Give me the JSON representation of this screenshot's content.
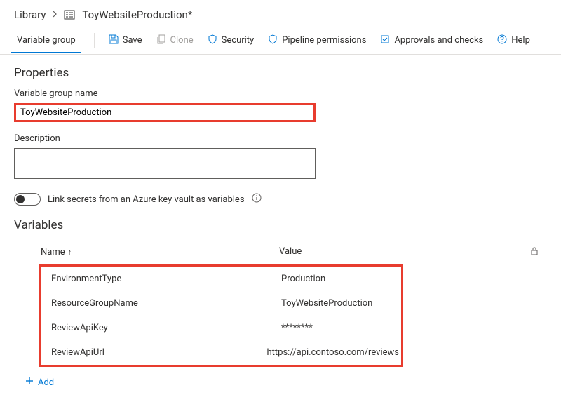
{
  "breadcrumb": {
    "library": "Library",
    "title": "ToyWebsiteProduction*"
  },
  "tabs": {
    "variable_group": "Variable group"
  },
  "toolbar": {
    "save": "Save",
    "clone": "Clone",
    "security": "Security",
    "pipeline_permissions": "Pipeline permissions",
    "approvals_checks": "Approvals and checks",
    "help": "Help"
  },
  "properties": {
    "section_title": "Properties",
    "name_label": "Variable group name",
    "name_value": "ToyWebsiteProduction",
    "description_label": "Description",
    "description_value": "",
    "link_secrets_label": "Link secrets from an Azure key vault as variables"
  },
  "variables": {
    "section_title": "Variables",
    "col_name": "Name",
    "col_value": "Value",
    "rows": [
      {
        "name": "EnvironmentType",
        "value": "Production"
      },
      {
        "name": "ResourceGroupName",
        "value": "ToyWebsiteProduction"
      },
      {
        "name": "ReviewApiKey",
        "value": "********"
      },
      {
        "name": "ReviewApiUrl",
        "value": "https://api.contoso.com/reviews"
      }
    ],
    "add_label": "Add"
  }
}
